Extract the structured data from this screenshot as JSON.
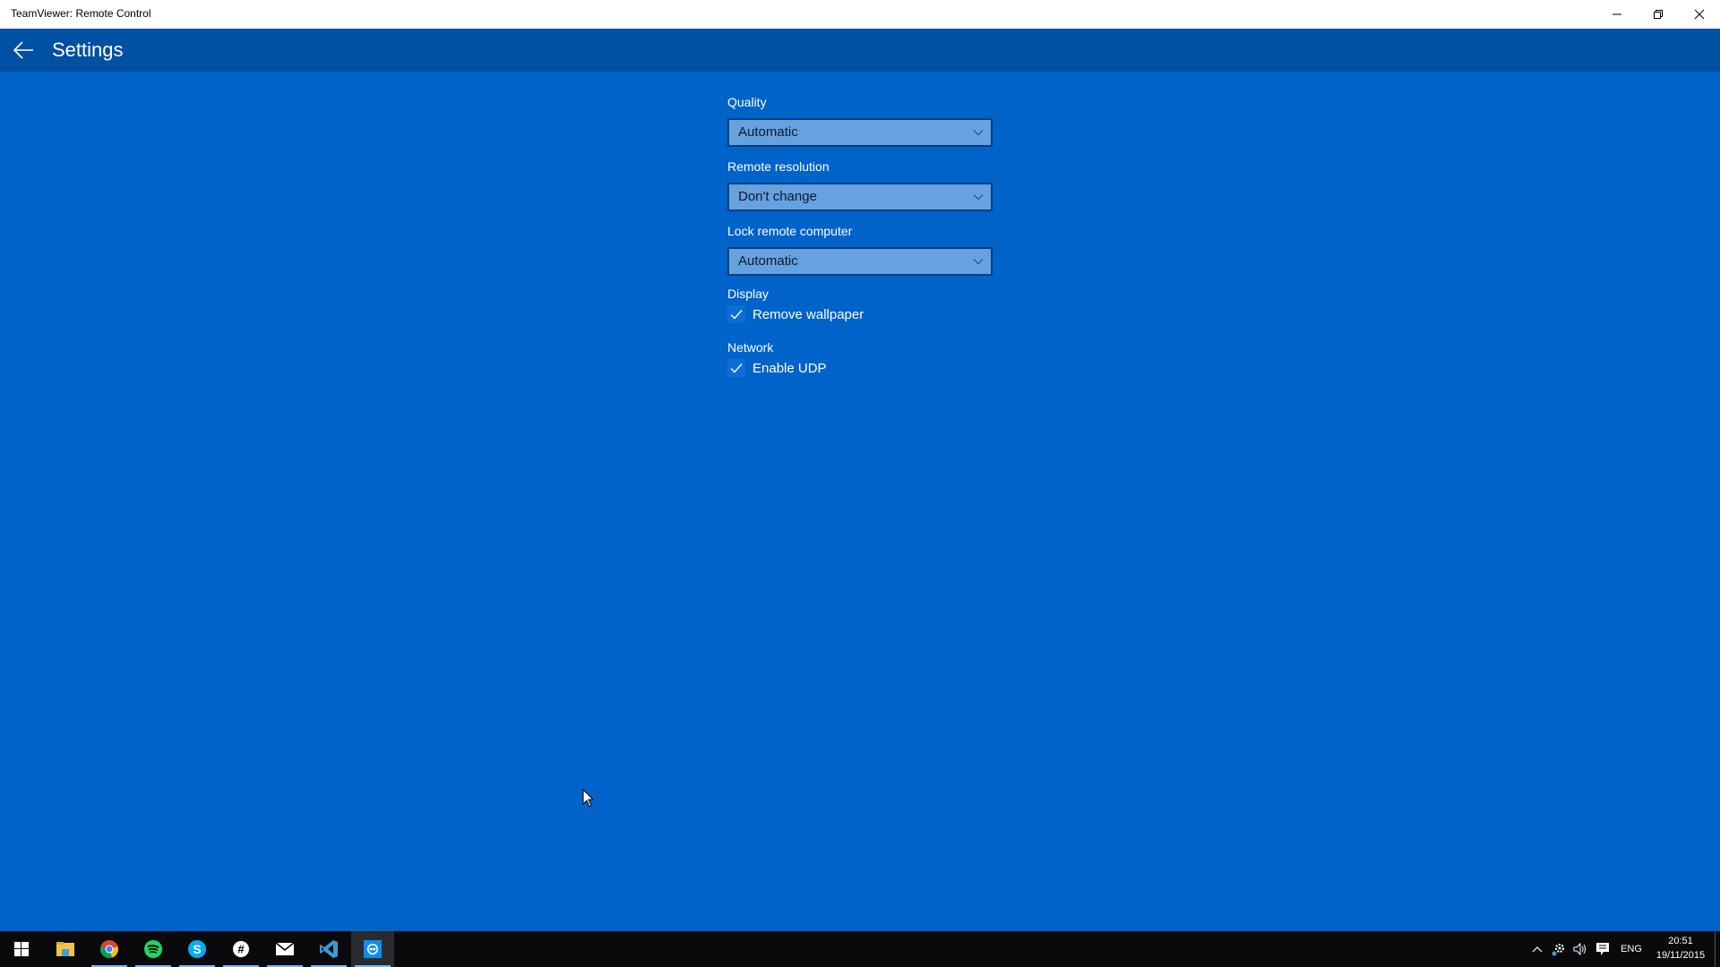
{
  "window": {
    "title": "TeamViewer: Remote Control",
    "controls": [
      "minimize-icon",
      "restore-icon",
      "close-icon"
    ]
  },
  "appbar": {
    "back_icon": "arrow-left-icon",
    "title": "Settings"
  },
  "settings": {
    "quality": {
      "label": "Quality",
      "value": "Automatic"
    },
    "remote_resolution": {
      "label": "Remote resolution",
      "value": "Don't change"
    },
    "lock_remote_computer": {
      "label": "Lock remote computer",
      "value": "Automatic"
    },
    "display": {
      "label": "Display",
      "remove_wallpaper": {
        "label": "Remove wallpaper",
        "checked": true
      }
    },
    "network": {
      "label": "Network",
      "enable_udp": {
        "label": "Enable UDP",
        "checked": true
      }
    }
  },
  "taskbar": {
    "apps": [
      {
        "name": "start",
        "icon": "windows-logo-icon"
      },
      {
        "name": "file-explorer",
        "icon": "folder-icon",
        "running": false
      },
      {
        "name": "chrome",
        "icon": "chrome-icon",
        "running": true
      },
      {
        "name": "spotify",
        "icon": "spotify-icon",
        "running": true
      },
      {
        "name": "skype",
        "icon": "skype-icon",
        "running": true
      },
      {
        "name": "slack",
        "icon": "slack-icon",
        "running": true
      },
      {
        "name": "mail",
        "icon": "mail-icon",
        "running": true
      },
      {
        "name": "visual-studio-code",
        "icon": "vscode-icon",
        "running": true
      },
      {
        "name": "teamviewer",
        "icon": "teamviewer-icon",
        "running": true,
        "active": true
      }
    ],
    "tray": {
      "language": "ENG",
      "time": "20:51",
      "date": "19/11/2015"
    }
  },
  "colors": {
    "background": "#0063c9",
    "appbar": "#0050a3",
    "combo_fill": "#66a1e0",
    "combo_border": "#003f80",
    "taskbar": "#0a0a0d",
    "running_indicator": "#76b9ed"
  }
}
